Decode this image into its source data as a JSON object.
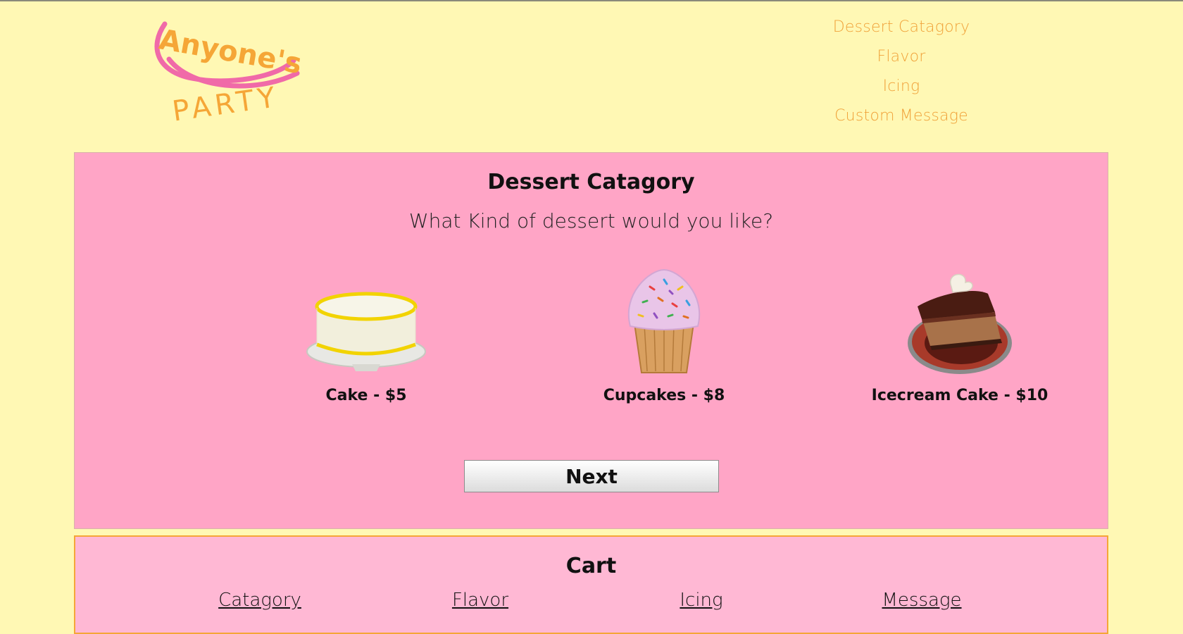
{
  "logo": {
    "line1": "Anyone's",
    "line2": "PARTY"
  },
  "nav": {
    "items": [
      {
        "label": "Dessert Catagory"
      },
      {
        "label": "Flavor"
      },
      {
        "label": "Icing"
      },
      {
        "label": "Custom Message"
      }
    ]
  },
  "dessert": {
    "title": "Dessert Catagory",
    "question": "What Kind of dessert would you like?",
    "options": [
      {
        "label": "Cake - $5",
        "icon": "cake-image"
      },
      {
        "label": "Cupcakes - $8",
        "icon": "cupcake-image"
      },
      {
        "label": "Icecream Cake - $10",
        "icon": "icecream-cake-image"
      }
    ],
    "next_label": "Next"
  },
  "cart": {
    "title": "Cart",
    "columns": [
      {
        "label": "Catagory"
      },
      {
        "label": "Flavor"
      },
      {
        "label": "Icing"
      },
      {
        "label": "Message"
      }
    ]
  },
  "colors": {
    "background": "#fff8b4",
    "panel": "#ffa5c6",
    "cart": "#ffb8d4",
    "nav_text": "#f0a23a",
    "logo_orange": "#f5a637",
    "logo_pink": "#f06aa8"
  }
}
